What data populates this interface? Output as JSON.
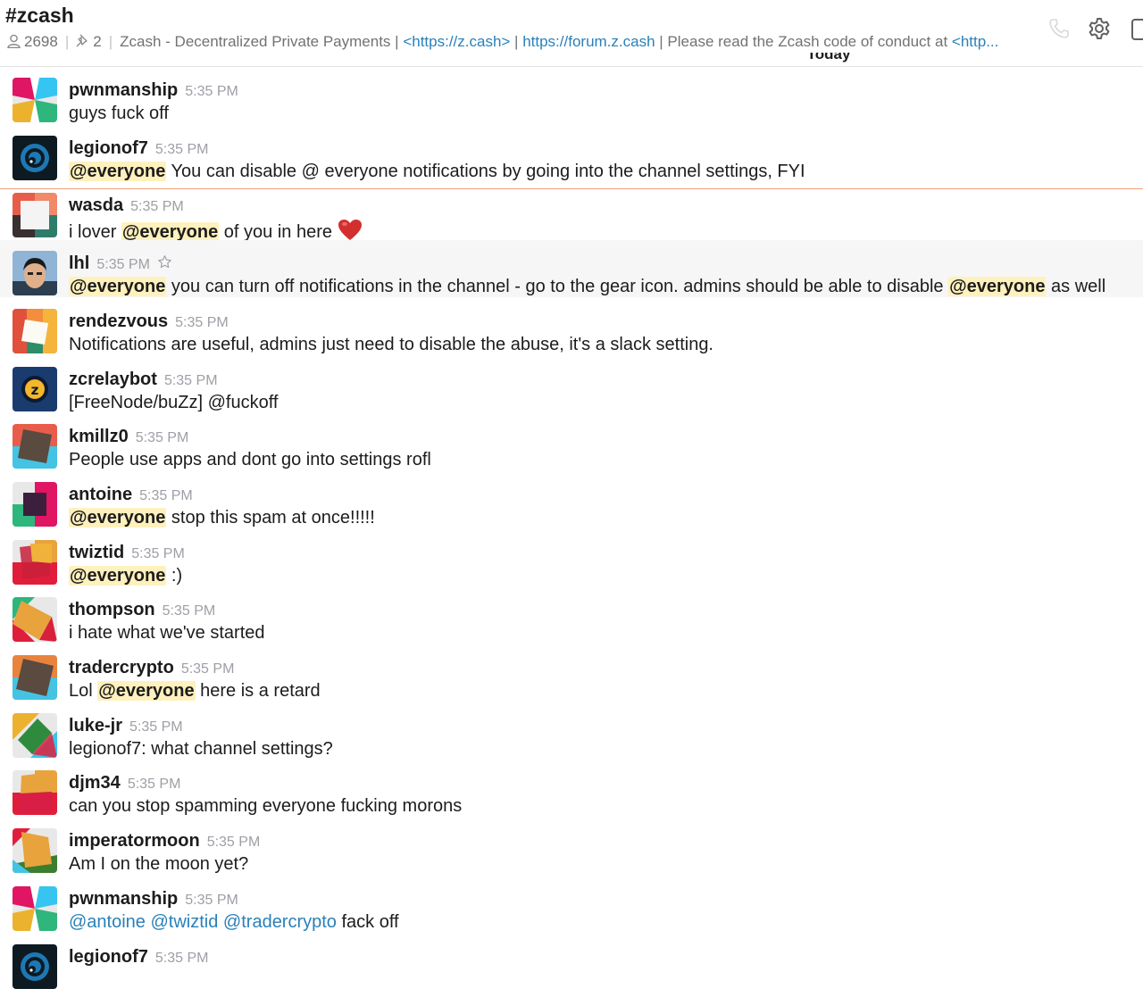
{
  "channel": {
    "name": "#zcash",
    "member_count": "2698",
    "pinned_count": "2",
    "topic_prefix": "Zcash - Decentralized Private Payments |",
    "topic_link1": "<https://z.cash>",
    "topic_link2": "https://forum.z.cash",
    "topic_suffix": "| Please read the Zcash code of conduct at",
    "topic_link3": "<http..."
  },
  "header_icons": [
    "phone-icon",
    "gear-icon",
    "details-panel-icon"
  ],
  "day_divider": "Today",
  "messages": [
    {
      "user": "pwnmanship",
      "time": "5:35 PM",
      "avatar": "pwnmanship-avatar",
      "segments": [
        {
          "t": "guys fuck off"
        }
      ]
    },
    {
      "user": "legionof7",
      "time": "5:35 PM",
      "avatar": "legionof7-avatar",
      "segments": [
        {
          "t": "@everyone",
          "mention_all": true
        },
        {
          "t": " You can disable @ everyone notifications by going into the channel settings, FYI"
        }
      ]
    },
    {
      "user": "wasda",
      "time": "5:35 PM",
      "avatar": "wasda-avatar",
      "segments": [
        {
          "t": "i lover "
        },
        {
          "t": "@everyone",
          "mention_all": true
        },
        {
          "t": " of you in here"
        }
      ],
      "emoji": "red-heart-emoji"
    },
    {
      "user": "lhl",
      "time": "5:35 PM",
      "avatar": "lhl-avatar",
      "star": true,
      "hover": true,
      "segments": [
        {
          "t": "@everyone",
          "mention_all": true
        },
        {
          "t": " you can turn off notifications in the channel - go to the gear icon. admins should be able to disable "
        },
        {
          "t": "@everyone",
          "mention_all": true
        },
        {
          "t": " as well"
        }
      ]
    },
    {
      "user": "rendezvous",
      "time": "5:35 PM",
      "avatar": "rendezvous-avatar",
      "segments": [
        {
          "t": "Notifications are useful, admins just need to disable the abuse, it's a slack setting."
        }
      ]
    },
    {
      "user": "zcrelaybot",
      "time": "5:35 PM",
      "avatar": "zcrelaybot-avatar",
      "segments": [
        {
          "t": "[FreeNode/buZz] @fuckoff"
        }
      ]
    },
    {
      "user": "kmillz0",
      "time": "5:35 PM",
      "avatar": "kmillz0-avatar",
      "segments": [
        {
          "t": "People use apps and dont go into settings rofl"
        }
      ]
    },
    {
      "user": "antoine",
      "time": "5:35 PM",
      "avatar": "antoine-avatar",
      "segments": [
        {
          "t": "@everyone",
          "mention_all": true
        },
        {
          "t": " stop this spam at once!!!!!"
        }
      ]
    },
    {
      "user": "twiztid",
      "time": "5:35 PM",
      "avatar": "twiztid-avatar",
      "segments": [
        {
          "t": "@everyone",
          "mention_all": true
        },
        {
          "t": " :)"
        }
      ]
    },
    {
      "user": "thompson",
      "time": "5:35 PM",
      "avatar": "thompson-avatar",
      "segments": [
        {
          "t": "i hate what we've started"
        }
      ]
    },
    {
      "user": "tradercrypto",
      "time": "5:35 PM",
      "avatar": "tradercrypto-avatar",
      "segments": [
        {
          "t": "Lol "
        },
        {
          "t": "@everyone",
          "mention_all": true
        },
        {
          "t": " here is a retard"
        }
      ]
    },
    {
      "user": "luke-jr",
      "time": "5:35 PM",
      "avatar": "luke-jr-avatar",
      "segments": [
        {
          "t": "legionof7: what channel settings?"
        }
      ]
    },
    {
      "user": "djm34",
      "time": "5:35 PM",
      "avatar": "djm34-avatar",
      "segments": [
        {
          "t": "can you stop spamming everyone fucking morons"
        }
      ]
    },
    {
      "user": "imperatormoon",
      "time": "5:35 PM",
      "avatar": "imperatormoon-avatar",
      "segments": [
        {
          "t": "Am I on the moon yet?"
        }
      ]
    },
    {
      "user": "pwnmanship",
      "time": "5:35 PM",
      "avatar": "pwnmanship-avatar",
      "segments": [
        {
          "t": "@antoine",
          "mention": true
        },
        {
          "t": " "
        },
        {
          "t": "@twiztid",
          "mention": true
        },
        {
          "t": " "
        },
        {
          "t": "@tradercrypto",
          "mention": true
        },
        {
          "t": " fack off"
        }
      ]
    },
    {
      "user": "legionof7",
      "time": "5:35 PM",
      "avatar": "legionof7-avatar",
      "segments": []
    }
  ],
  "colors": {
    "mention_all_bg": "#fff1bd",
    "mention_link": "#2a80b9",
    "new_message_divider": "#f1a07b",
    "timestamp": "#9e9ea6"
  }
}
